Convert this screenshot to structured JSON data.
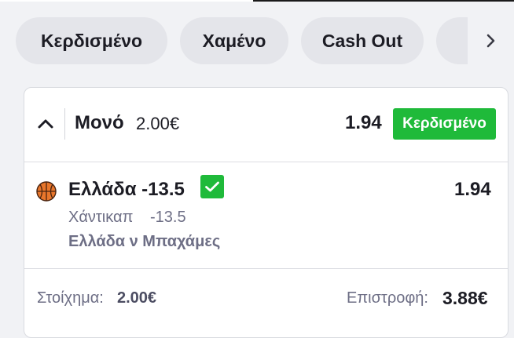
{
  "filters": {
    "items": [
      {
        "label": "Κερδισμένο"
      },
      {
        "label": "Χαμένο"
      },
      {
        "label": "Cash Out"
      }
    ]
  },
  "bet": {
    "type": "Μονό",
    "stake": "2.00€",
    "total_odds": "1.94",
    "status": "Κερδισμένο",
    "selection": {
      "sport_icon": "basketball-icon",
      "name": "Ελλάδα -13.5",
      "odds": "1.94",
      "market": "Χάντικαπ",
      "line": "-13.5",
      "event": "Ελλάδα ν Μπαχάμες"
    },
    "footer": {
      "stake_label": "Στοίχημα:",
      "stake_value": "2.00€",
      "return_label": "Επιστροφή:",
      "return_value": "3.88€"
    }
  },
  "colors": {
    "won": "#1fba3a",
    "background": "#f1f2f5",
    "chip": "#e4e5ea",
    "muted_text": "#6d6e85"
  }
}
